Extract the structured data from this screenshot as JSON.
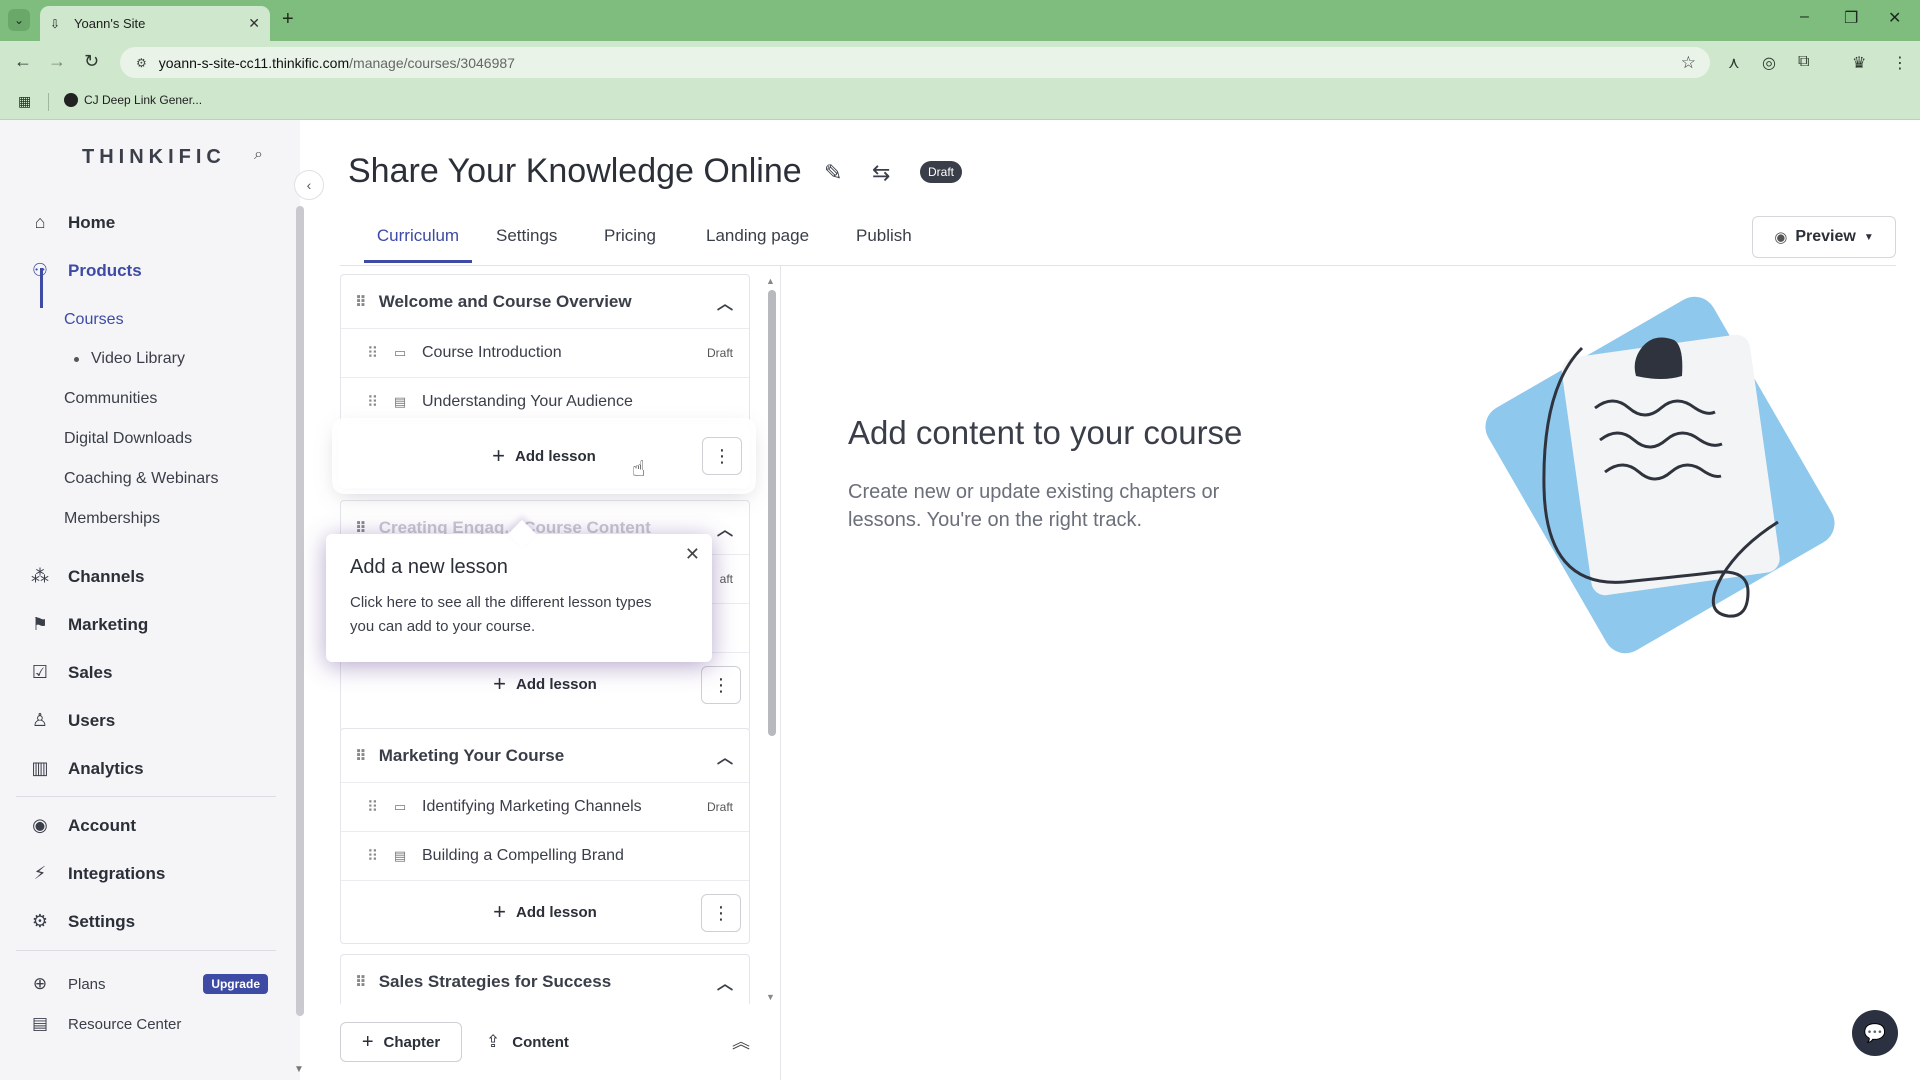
{
  "browser": {
    "tab_title": "Yoann's Site",
    "url_host": "yoann-s-site-cc11.thinkific.com",
    "url_path": "/manage/courses/3046987",
    "bookmark": "CJ Deep Link Gener..."
  },
  "sidebar": {
    "logo": "THINKIFIC",
    "items": [
      {
        "label": "Home",
        "icon": "home-icon"
      },
      {
        "label": "Products",
        "icon": "products-icon"
      },
      {
        "label": "Channels",
        "icon": "channels-icon"
      },
      {
        "label": "Marketing",
        "icon": "marketing-icon"
      },
      {
        "label": "Sales",
        "icon": "sales-icon"
      },
      {
        "label": "Users",
        "icon": "users-icon"
      },
      {
        "label": "Analytics",
        "icon": "analytics-icon"
      },
      {
        "label": "Account",
        "icon": "account-icon"
      },
      {
        "label": "Integrations",
        "icon": "integrations-icon"
      },
      {
        "label": "Settings",
        "icon": "settings-icon"
      }
    ],
    "products_sub": [
      "Courses",
      "Video Library",
      "Communities",
      "Digital Downloads",
      "Coaching & Webinars",
      "Memberships"
    ],
    "plans_label": "Plans",
    "upgrade_label": "Upgrade",
    "resource_label": "Resource Center"
  },
  "header": {
    "title": "Share Your Knowledge Online",
    "status": "Draft",
    "tabs": [
      "Curriculum",
      "Settings",
      "Pricing",
      "Landing page",
      "Publish"
    ],
    "preview_label": "Preview"
  },
  "curriculum": {
    "chapters": [
      {
        "title": "Welcome and Course Overview",
        "lessons": [
          {
            "title": "Course Introduction",
            "type": "video",
            "status": "Draft"
          },
          {
            "title": "Understanding Your Audience",
            "type": "text",
            "status": ""
          }
        ]
      },
      {
        "title": "Creating Engag... Course Content",
        "lessons": [
          {
            "title": "",
            "type": "video",
            "status": "aft"
          }
        ]
      },
      {
        "title": "Marketing Your Course",
        "lessons": [
          {
            "title": "Identifying Marketing Channels",
            "type": "video",
            "status": "Draft"
          },
          {
            "title": "Building a Compelling Brand",
            "type": "text",
            "status": ""
          }
        ]
      },
      {
        "title": "Sales Strategies for Success",
        "lessons": []
      }
    ],
    "add_lesson_label": "Add lesson",
    "chapter_button": "Chapter",
    "content_button": "Content"
  },
  "popover": {
    "title": "Add a new lesson",
    "body": "Click here to see all the different lesson types you can add to your course."
  },
  "empty_state": {
    "title": "Add content to your course",
    "subtitle": "Create new or update existing chapters or lessons. You're on the right track."
  },
  "colors": {
    "accent": "#3d4ba4",
    "browser_green": "#7fbd7e",
    "illustration_blue": "#8ec8ec"
  }
}
